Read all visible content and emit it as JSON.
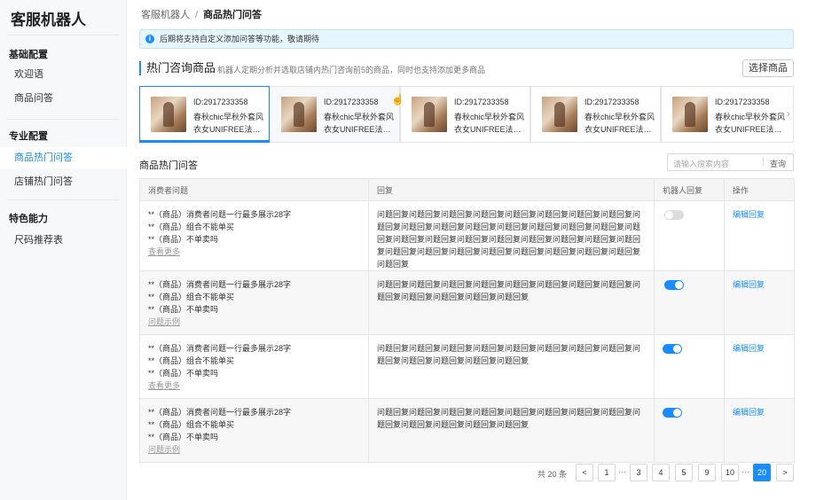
{
  "sidebar": {
    "app_title": "客服机器人",
    "groups": [
      {
        "label": "基础配置"
      },
      {
        "label": "专业配置"
      },
      {
        "label": "特色能力"
      }
    ],
    "items": [
      {
        "label": "欢迎语"
      },
      {
        "label": "商品问答"
      },
      {
        "label": "商品热门问答"
      },
      {
        "label": "店铺热门问答"
      },
      {
        "label": "尺码推荐表"
      }
    ]
  },
  "breadcrumb": {
    "root": "客服机器人",
    "separator": "/",
    "current": "商品热门问答"
  },
  "notice": {
    "icon": "info-icon",
    "text": "后期将支持自定义添加问答等功能，敬请期待"
  },
  "hot_products": {
    "title": "热门咨询商品",
    "desc": "机器人定期分析并选取店铺内热门咨询前5的商品，同时也支持添加更多商品",
    "select_button": "选择商品",
    "cards": [
      {
        "id": "ID:2917233358",
        "name": "春秋chic早秋外套风衣女UNIFREE法…"
      },
      {
        "id": "ID:2917233358",
        "name": "春秋chic早秋外套风衣女UNIFREE法…"
      },
      {
        "id": "ID:2917233358",
        "name": "春秋chic早秋外套风衣女UNIFREE法…"
      },
      {
        "id": "ID:2917233358",
        "name": "春秋chic早秋外套风衣女UNIFREE法…"
      },
      {
        "id": "ID:2917233358",
        "name": "春秋chic早秋外套风衣女UNIFREE法…"
      }
    ],
    "scroll_icon": "chevron-right-icon"
  },
  "qa": {
    "title": "商品热门问答",
    "search_placeholder": "请输入搜索内容",
    "search_button": "查询",
    "columns": [
      "消费者问题",
      "回复",
      "机器人回复",
      "操作"
    ],
    "rows": [
      {
        "q1": "**（商品）消费者问题一行最多展示28字",
        "q2": "**（商品）组合不能单买",
        "q3": "**（商品）不单卖吗",
        "more": "查看更多",
        "reply": "问题回复问题回复问题回复问题回复问题回复问题回复问题回复问题回复问题回复问题回复问题回复问题回复问题回复问题回复问题回复问题回复问题回复问题回复问题回复问题回复问题回复问题回复问题回复问题回复问题回复问题回复问题回复问题回复问题回复问题回复问题回复问题回复问题回复问题回复",
        "robot_on": false,
        "action": "编辑回复"
      },
      {
        "q1": "**（商品）消费者问题一行最多展示28字",
        "q2": "**（商品）组合不能单买",
        "q3": "**（商品）不单卖吗",
        "more": "问题示例",
        "reply": "问题回复问题回复问题回复问题回复问题回复问题回复问题回复问题回复问题回复问题回复问题回复问题回复问题回复",
        "robot_on": true,
        "action": "编辑回复"
      },
      {
        "q1": "**（商品）消费者问题一行最多展示28字",
        "q2": "**（商品）组合不能单买",
        "q3": "**（商品）不单卖吗",
        "more": "查看更多",
        "reply": "问题回复问题回复问题回复问题回复问题回复问题回复问题回复问题回复问题回复问题回复问题回复问题回复问题回复",
        "robot_on": true,
        "action": "编辑回复"
      },
      {
        "q1": "**（商品）消费者问题一行最多展示28字",
        "q2": "**（商品）组合不能单买",
        "q3": "**（商品）不单卖吗",
        "more": "问题示例",
        "reply": "问题回复问题回复问题回复问题回复问题回复问题回复问题回复问题回复问题回复问题回复问题回复问题回复问题回复",
        "robot_on": true,
        "action": "编辑回复"
      }
    ]
  },
  "pagination": {
    "total": "共 20 条",
    "prev": "<",
    "next": ">",
    "ellipsis": "···",
    "pages": [
      "1",
      "3",
      "4",
      "5",
      "9",
      "10",
      "20"
    ],
    "current": "20"
  }
}
